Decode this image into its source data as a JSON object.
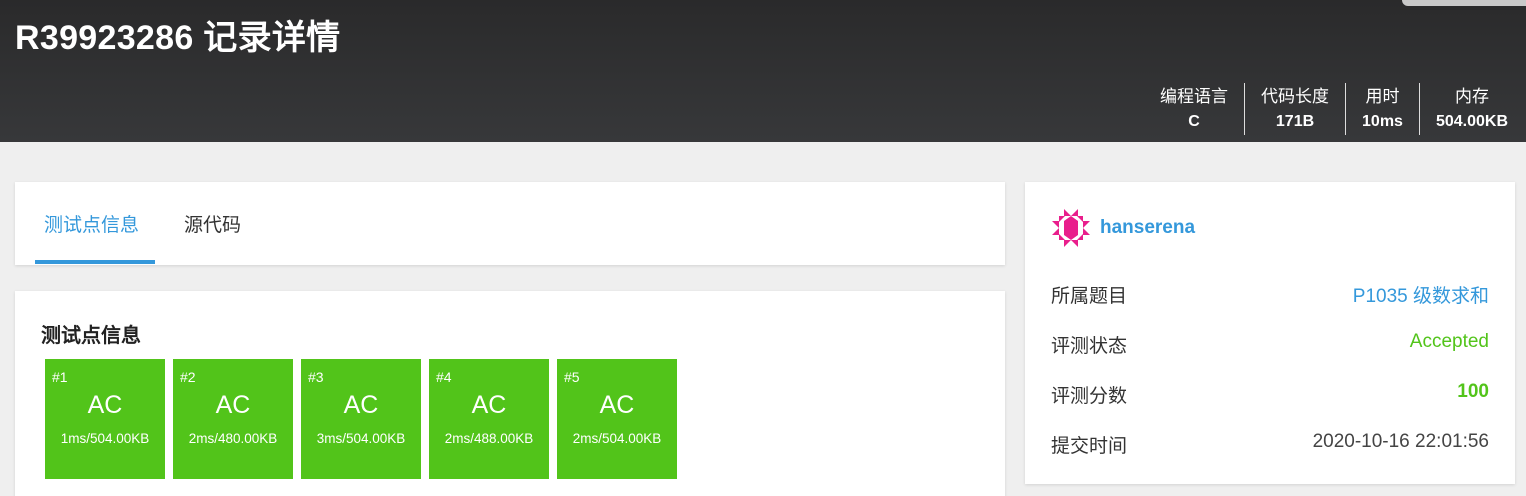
{
  "header": {
    "title": "R39923286 记录详情",
    "stats": [
      {
        "label": "编程语言",
        "value": "C"
      },
      {
        "label": "代码长度",
        "value": "171B"
      },
      {
        "label": "用时",
        "value": "10ms"
      },
      {
        "label": "内存",
        "value": "504.00KB"
      }
    ]
  },
  "tabs": [
    {
      "label": "测试点信息",
      "active": true
    },
    {
      "label": "源代码",
      "active": false
    }
  ],
  "tests": {
    "title": "测试点信息",
    "cases": [
      {
        "id": "#1",
        "status": "AC",
        "meta": "1ms/504.00KB"
      },
      {
        "id": "#2",
        "status": "AC",
        "meta": "2ms/480.00KB"
      },
      {
        "id": "#3",
        "status": "AC",
        "meta": "3ms/504.00KB"
      },
      {
        "id": "#4",
        "status": "AC",
        "meta": "2ms/488.00KB"
      },
      {
        "id": "#5",
        "status": "AC",
        "meta": "2ms/504.00KB"
      }
    ]
  },
  "sidebar": {
    "username": "hanserena",
    "rows": [
      {
        "label": "所属题目",
        "value": "P1035 级数求和"
      },
      {
        "label": "评测状态",
        "value": "Accepted"
      },
      {
        "label": "评测分数",
        "value": "100"
      },
      {
        "label": "提交时间",
        "value": "2020-10-16 22:01:56"
      }
    ]
  },
  "colors": {
    "accent": "#3498db",
    "accepted": "#52c41a",
    "header_bg": "#2f3032",
    "avatar": "#e91e8c"
  }
}
